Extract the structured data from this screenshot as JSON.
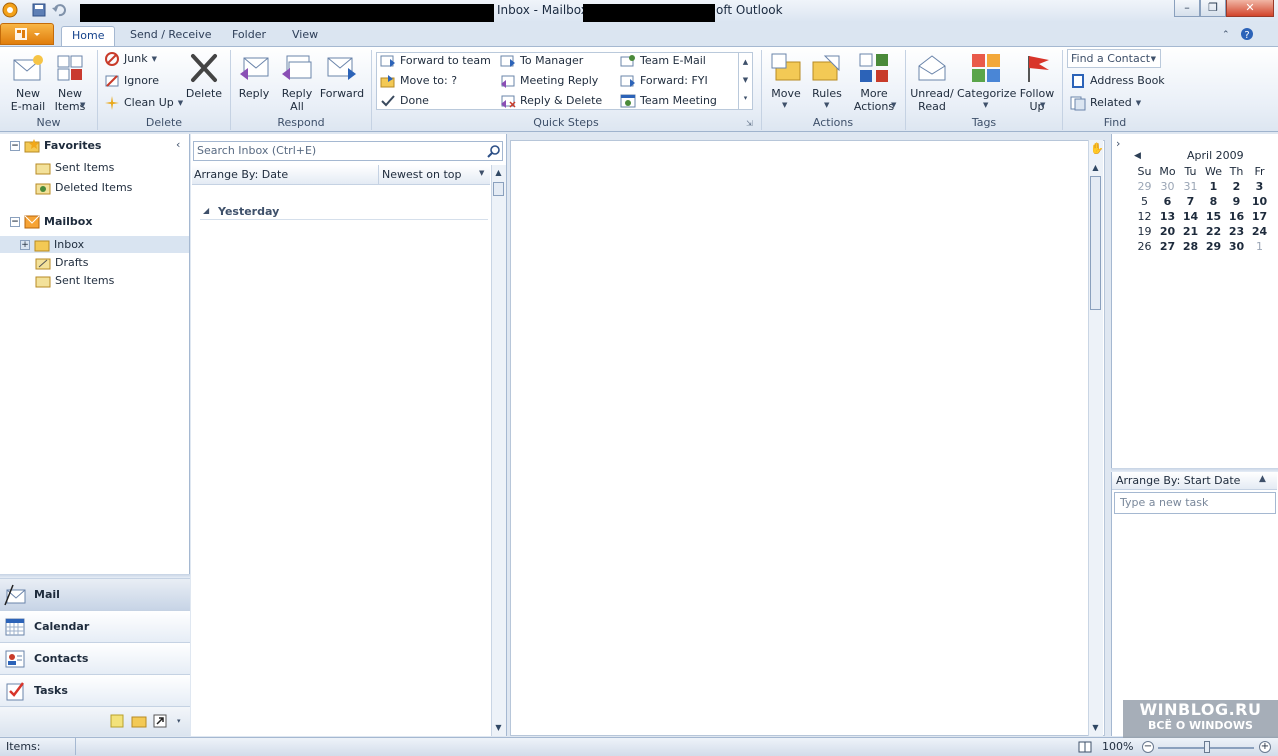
{
  "window": {
    "title_start": "Inbox - Mailbox",
    "title_end": "oft Outlook"
  },
  "tabs": [
    {
      "label": "Home"
    },
    {
      "label": "Send / Receive"
    },
    {
      "label": "Folder"
    },
    {
      "label": "View"
    }
  ],
  "ribbon": {
    "new": {
      "email": "New\nE-mail",
      "items": "New\nItems",
      "group": "New"
    },
    "delete": {
      "junk": "Junk",
      "ignore": "Ignore",
      "cleanup": "Clean Up",
      "delete": "Delete",
      "group": "Delete"
    },
    "respond": {
      "reply": "Reply",
      "reply_all": "Reply\nAll",
      "forward": "Forward",
      "group": "Respond"
    },
    "quick_steps": {
      "items": [
        "Forward to team",
        "Move to: ?",
        "Done",
        "To Manager",
        "Meeting Reply",
        "Reply & Delete",
        "Team E-Mail",
        "Forward: FYI",
        "Team Meeting"
      ],
      "group": "Quick Steps"
    },
    "actions": {
      "move": "Move",
      "rules": "Rules",
      "more": "More\nActions",
      "group": "Actions"
    },
    "tags": {
      "unread": "Unread/\nRead",
      "categorize": "Categorize",
      "follow": "Follow\nUp",
      "group": "Tags"
    },
    "find": {
      "contact": "Find a Contact",
      "address": "Address Book",
      "related": "Related",
      "group": "Find"
    }
  },
  "nav": {
    "favorites": "Favorites",
    "fav_items": [
      "Sent Items",
      "Deleted Items"
    ],
    "mailbox": "Mailbox",
    "mb_items": [
      "Inbox",
      "Drafts",
      "Sent Items"
    ],
    "buttons": [
      "Mail",
      "Calendar",
      "Contacts",
      "Tasks"
    ]
  },
  "list": {
    "search_placeholder": "Search Inbox (Ctrl+E)",
    "arrange": "Arrange By: Date",
    "order": "Newest on top",
    "group": "Yesterday"
  },
  "calendar": {
    "month": "April 2009",
    "days": [
      "Su",
      "Mo",
      "Tu",
      "We",
      "Th",
      "Fr"
    ],
    "weeks": [
      [
        "29",
        "30",
        "31",
        "1",
        "2",
        "3"
      ],
      [
        "5",
        "6",
        "7",
        "8",
        "9",
        "10"
      ],
      [
        "12",
        "13",
        "14",
        "15",
        "16",
        "17"
      ],
      [
        "19",
        "20",
        "21",
        "22",
        "23",
        "24"
      ],
      [
        "26",
        "27",
        "28",
        "29",
        "30",
        "1"
      ]
    ]
  },
  "tasks": {
    "arrange": "Arrange By: Start Date",
    "placeholder": "Type a new task"
  },
  "status": {
    "items": "Items:",
    "zoom": "100%"
  },
  "watermark": {
    "line1": "WINBLOG.RU",
    "line2": "ВСЁ О WINDOWS"
  },
  "colors": {
    "accent": "#15428b",
    "file_tab": "#e9890f",
    "background": "#dfe7f1"
  }
}
